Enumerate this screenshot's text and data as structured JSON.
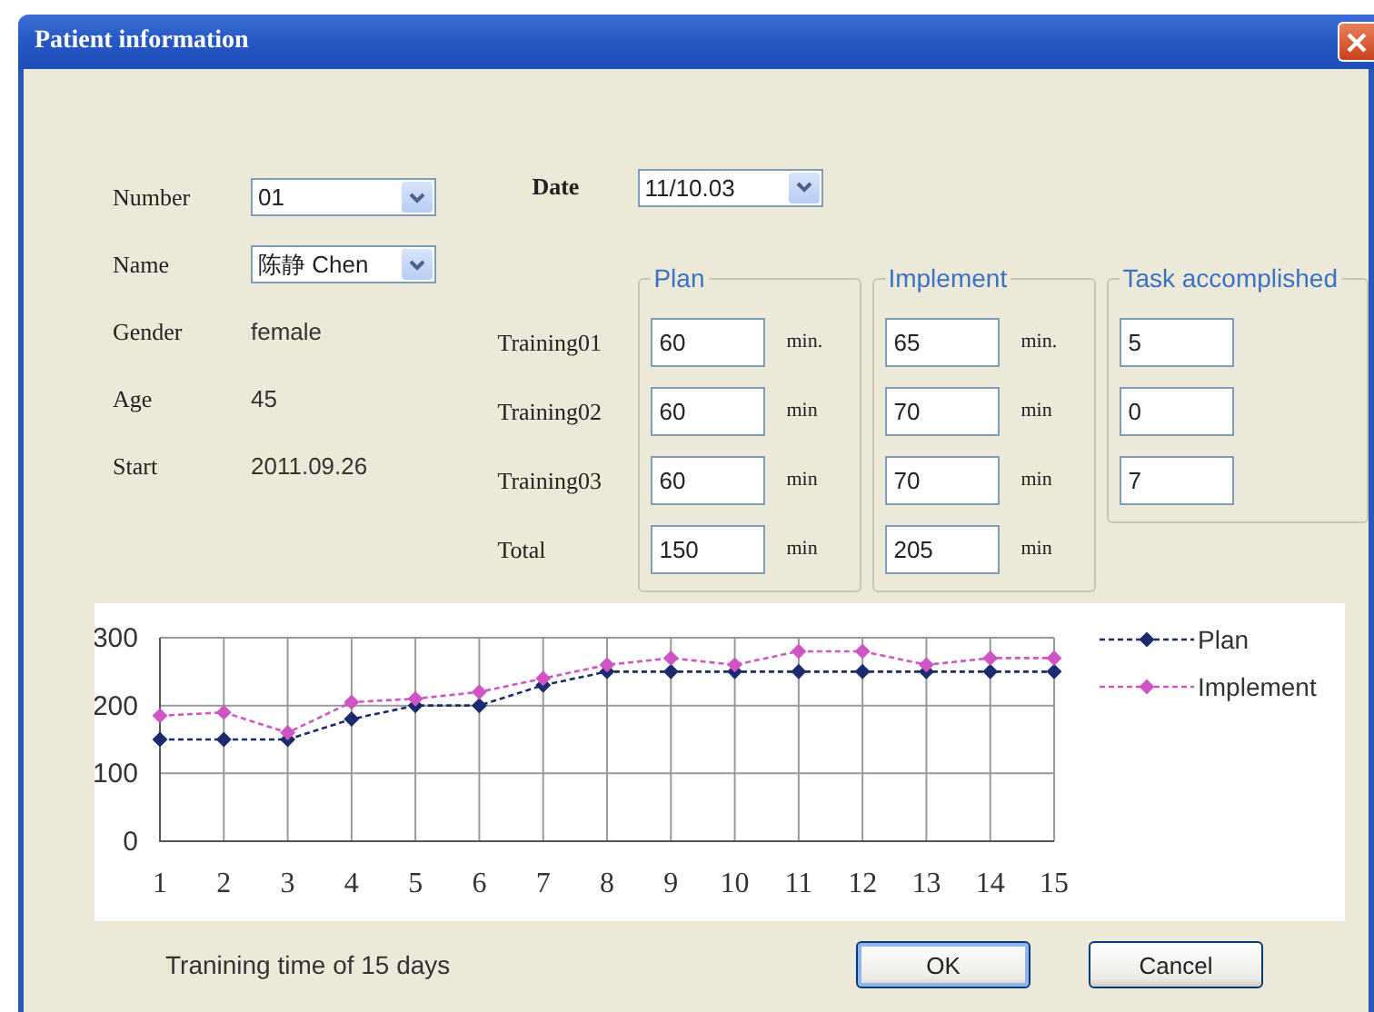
{
  "window": {
    "title": "Patient information"
  },
  "patient": [
    {
      "label": "Number",
      "kind": "combo",
      "value": "01"
    },
    {
      "label": "Name",
      "kind": "combo",
      "value": "陈静 Chen"
    },
    {
      "label": "Gender",
      "kind": "text",
      "value": "female"
    },
    {
      "label": "Age",
      "kind": "text",
      "value": "45"
    },
    {
      "label": "Start",
      "kind": "text",
      "value": "2011.09.26"
    }
  ],
  "date": {
    "label": "Date",
    "value": "11/10.03"
  },
  "training": {
    "rows": [
      "Training01",
      "Training02",
      "Training03",
      "Total"
    ],
    "groups": [
      {
        "title": "Plan",
        "cells": [
          {
            "value": "60",
            "unit": "min."
          },
          {
            "value": "60",
            "unit": "min"
          },
          {
            "value": "60",
            "unit": "min"
          },
          {
            "value": "150",
            "unit": "min"
          }
        ]
      },
      {
        "title": "Implement",
        "cells": [
          {
            "value": "65",
            "unit": "min."
          },
          {
            "value": "70",
            "unit": "min"
          },
          {
            "value": "70",
            "unit": "min"
          },
          {
            "value": "205",
            "unit": "min"
          }
        ]
      },
      {
        "title": "Task accomplished",
        "cells": [
          {
            "value": "5"
          },
          {
            "value": "0"
          },
          {
            "value": "7"
          }
        ]
      }
    ]
  },
  "chart": {
    "chart_data": {
      "type": "line",
      "x": [
        1,
        2,
        3,
        4,
        5,
        6,
        7,
        8,
        9,
        10,
        11,
        12,
        13,
        14,
        15
      ],
      "xlim": [
        1,
        15
      ],
      "ylim": [
        0,
        300
      ],
      "grid": true,
      "yticks": [
        0,
        100,
        200,
        300
      ],
      "xticks": [
        1,
        2,
        3,
        4,
        5,
        6,
        7,
        8,
        9,
        10,
        11,
        12,
        13,
        14,
        15
      ],
      "series": [
        {
          "name": "Plan",
          "color": "#1c2a6e",
          "line_style": "dashed",
          "marker": "diamond",
          "values": [
            150,
            150,
            150,
            180,
            200,
            200,
            230,
            250,
            250,
            250,
            250,
            250,
            250,
            250,
            250
          ]
        },
        {
          "name": "Implement",
          "color": "#d055c4",
          "line_style": "dashed",
          "marker": "diamond",
          "values": [
            185,
            190,
            160,
            205,
            210,
            220,
            240,
            260,
            270,
            260,
            280,
            280,
            260,
            270,
            270
          ]
        }
      ]
    }
  },
  "caption": "Tranining time of 15 days",
  "buttons": [
    {
      "label": "OK",
      "default": true
    },
    {
      "label": "Cancel",
      "default": false
    }
  ]
}
